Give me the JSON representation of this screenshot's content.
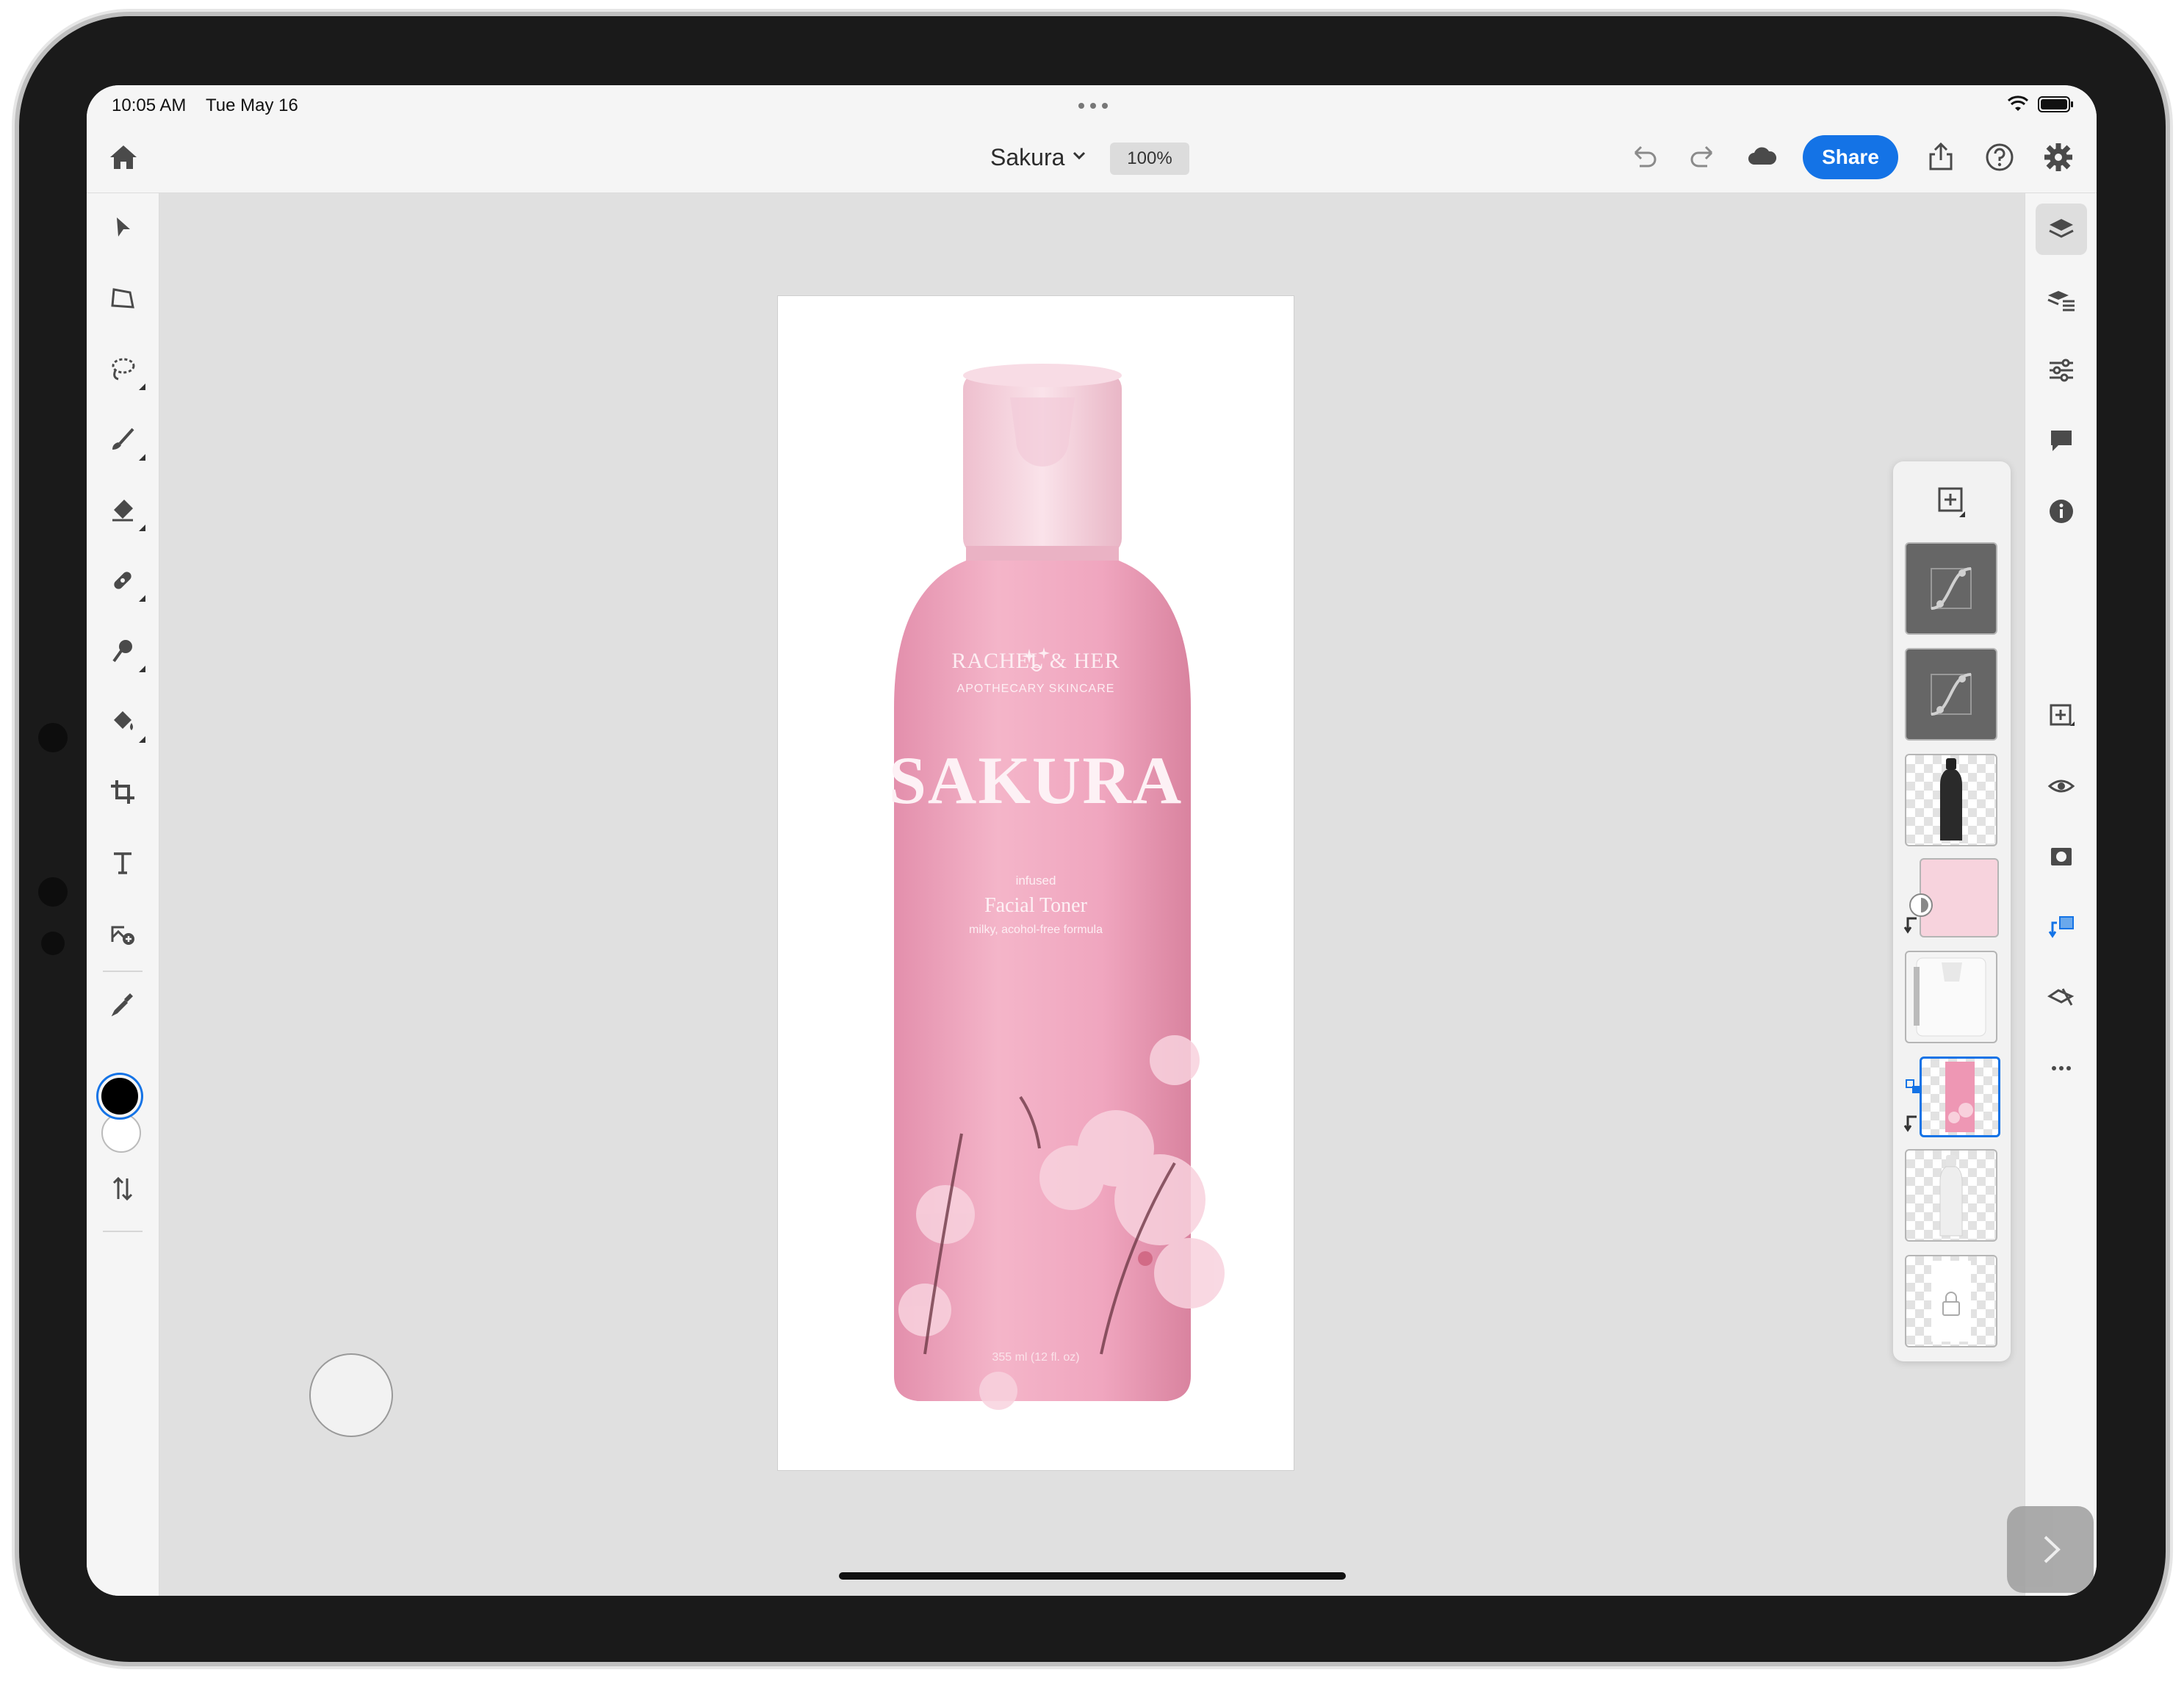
{
  "status_bar": {
    "time": "10:05 AM",
    "date": "Tue May 16"
  },
  "header": {
    "document_title": "Sakura",
    "zoom": "100%",
    "share_label": "Share"
  },
  "product": {
    "brand_line1": "RACHEL & HER",
    "brand_line2": "APOTHECARY SKINCARE",
    "name": "SAKURA",
    "infused": "infused",
    "type": "Facial Toner",
    "formula": "milky, acohol-free formula",
    "volume": "355 ml (12 fl. oz)"
  },
  "left_tools": [
    "select-icon",
    "transform-icon",
    "lasso-icon",
    "brush-icon",
    "eraser-icon",
    "healing-icon",
    "clone-icon",
    "fill-icon",
    "crop-icon",
    "text-icon",
    "place-image-icon",
    "eyedropper-icon"
  ],
  "right_rail": [
    "layers-icon",
    "layer-properties-icon",
    "adjustments-icon",
    "comments-icon",
    "info-icon",
    "add-layer-icon",
    "visibility-icon",
    "mask-icon",
    "clip-icon",
    "smudge-icon",
    "more-icon"
  ],
  "colors": {
    "accent": "#1473e6",
    "bottle_pink": "#f0a9bf",
    "cap_pink": "#f6d5df",
    "canvas_bg": "#e0e0e0",
    "foreground": "#000000",
    "background": "#ffffff"
  }
}
